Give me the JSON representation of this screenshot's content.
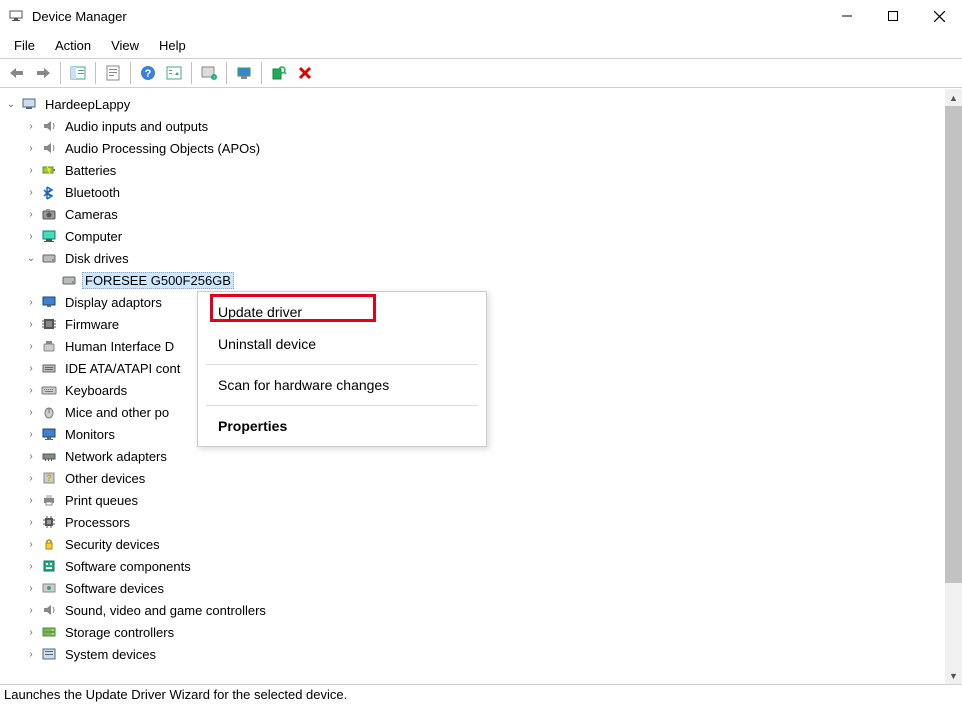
{
  "window": {
    "title": "Device Manager"
  },
  "menubar": {
    "file": "File",
    "action": "Action",
    "view": "View",
    "help": "Help"
  },
  "toolbar": {
    "back": "back",
    "forward": "forward",
    "showhide": "showhide",
    "properties": "properties",
    "help": "help",
    "showhide2": "showhide2",
    "print": "print",
    "monitor": "monitor",
    "hw": "hw"
  },
  "tree": {
    "root": "HardeepLappy",
    "children": [
      {
        "label": "Audio inputs and outputs",
        "expander": "›",
        "icon": "speaker"
      },
      {
        "label": "Audio Processing Objects (APOs)",
        "expander": "›",
        "icon": "speaker"
      },
      {
        "label": "Batteries",
        "expander": "›",
        "icon": "battery"
      },
      {
        "label": "Bluetooth",
        "expander": "›",
        "icon": "bluetooth"
      },
      {
        "label": "Cameras",
        "expander": "›",
        "icon": "camera"
      },
      {
        "label": "Computer",
        "expander": "›",
        "icon": "computer"
      },
      {
        "label": "Disk drives",
        "expander": "⌄",
        "icon": "disk",
        "children": [
          {
            "label": "FORESEE G500F256GB",
            "icon": "disk",
            "selected": true
          }
        ]
      },
      {
        "label": "Display adaptors",
        "expander": "›",
        "icon": "display"
      },
      {
        "label": "Firmware",
        "expander": "›",
        "icon": "firmware"
      },
      {
        "label": "Human Interface Devices",
        "expander": "›",
        "icon": "hid",
        "truncated": "Human Interface D"
      },
      {
        "label": "IDE ATA/ATAPI controllers",
        "expander": "›",
        "icon": "ide",
        "truncated": "IDE ATA/ATAPI cont"
      },
      {
        "label": "Keyboards",
        "expander": "›",
        "icon": "keyboard"
      },
      {
        "label": "Mice and other pointing devices",
        "expander": "›",
        "icon": "mouse",
        "truncated": "Mice and other po"
      },
      {
        "label": "Monitors",
        "expander": "›",
        "icon": "monitor"
      },
      {
        "label": "Network adapters",
        "expander": "›",
        "icon": "network"
      },
      {
        "label": "Other devices",
        "expander": "›",
        "icon": "other"
      },
      {
        "label": "Print queues",
        "expander": "›",
        "icon": "printer"
      },
      {
        "label": "Processors",
        "expander": "›",
        "icon": "cpu"
      },
      {
        "label": "Security devices",
        "expander": "›",
        "icon": "security"
      },
      {
        "label": "Software components",
        "expander": "›",
        "icon": "swcomp"
      },
      {
        "label": "Software devices",
        "expander": "›",
        "icon": "swdev"
      },
      {
        "label": "Sound, video and game controllers",
        "expander": "›",
        "icon": "sound"
      },
      {
        "label": "Storage controllers",
        "expander": "›",
        "icon": "storage"
      },
      {
        "label": "System devices",
        "expander": "›",
        "icon": "system",
        "truncated": "System devices"
      }
    ]
  },
  "context_menu": {
    "update_driver": "Update driver",
    "uninstall": "Uninstall device",
    "scan": "Scan for hardware changes",
    "properties": "Properties"
  },
  "statusbar": {
    "text": "Launches the Update Driver Wizard for the selected device."
  }
}
